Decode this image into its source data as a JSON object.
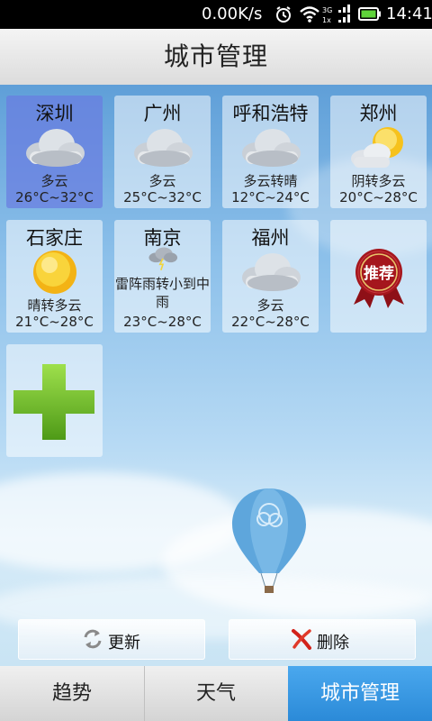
{
  "status_bar": {
    "net_speed": "0.00K/s",
    "time": "14:41",
    "signal_tags": [
      "3G",
      "1x"
    ]
  },
  "header": {
    "title": "城市管理"
  },
  "cities": [
    {
      "name": "深圳",
      "condition": "多云",
      "temp": "26°C~32°C",
      "icon": "cloudy-icon",
      "selected": true
    },
    {
      "name": "广州",
      "condition": "多云",
      "temp": "25°C~32°C",
      "icon": "cloudy-icon"
    },
    {
      "name": "呼和浩特",
      "condition": "多云转晴",
      "temp": "12°C~24°C",
      "icon": "cloudy-icon"
    },
    {
      "name": "郑州",
      "condition": "阴转多云",
      "temp": "20°C~28°C",
      "icon": "sun-cloud-icon"
    },
    {
      "name": "石家庄",
      "condition": "晴转多云",
      "temp": "21°C~28°C",
      "icon": "sun-icon"
    },
    {
      "name": "南京",
      "condition": "雷阵雨转小到中雨",
      "temp": "23°C~28°C",
      "icon": "thunderstorm-icon"
    },
    {
      "name": "福州",
      "condition": "多云",
      "temp": "22°C~28°C",
      "icon": "cloudy-icon"
    }
  ],
  "recommend": {
    "label": "推荐",
    "icon": "ribbon-badge-icon"
  },
  "add_city": {
    "icon": "plus-icon"
  },
  "actions": {
    "refresh": {
      "label": "更新",
      "icon": "refresh-icon"
    },
    "delete": {
      "label": "删除",
      "icon": "delete-x-icon"
    }
  },
  "tabs": [
    {
      "label": "趋势"
    },
    {
      "label": "天气"
    },
    {
      "label": "城市管理",
      "active": true
    }
  ],
  "colors": {
    "accent": "#2b8ad8",
    "selected_tile": "#6a7ee1",
    "plus_green": "#6fbf2a",
    "ribbon_red": "#b2181f"
  }
}
